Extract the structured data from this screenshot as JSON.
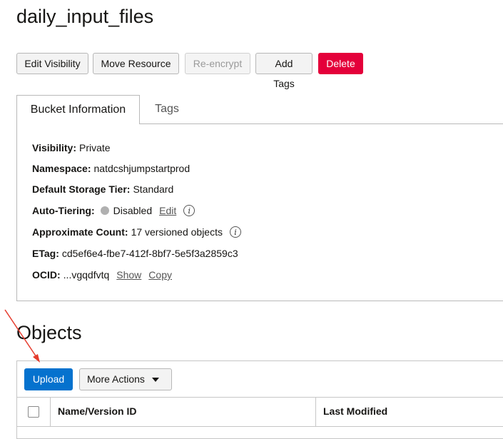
{
  "page": {
    "title": "daily_input_files"
  },
  "toolbar": {
    "edit_visibility": "Edit Visibility",
    "move_resource": "Move Resource",
    "re_encrypt": "Re-encrypt",
    "add_tags": "Add Tags",
    "delete": "Delete"
  },
  "tabs": {
    "bucket_information": "Bucket Information",
    "tags": "Tags"
  },
  "bucket_info": {
    "visibility": {
      "label": "Visibility:",
      "value": "Private"
    },
    "namespace": {
      "label": "Namespace:",
      "value": "natdcshjumpstartprod"
    },
    "storage_tier": {
      "label": "Default Storage Tier:",
      "value": "Standard"
    },
    "auto_tiering": {
      "label": "Auto-Tiering:",
      "value": "Disabled",
      "edit_link": "Edit"
    },
    "approx_count": {
      "label": "Approximate Count:",
      "value": "17 versioned objects"
    },
    "etag": {
      "label": "ETag:",
      "value": "cd5ef6e4-fbe7-412f-8bf7-5e5f3a2859c3"
    },
    "ocid": {
      "label": "OCID:",
      "value": "...vgqdfvtq",
      "show_link": "Show",
      "copy_link": "Copy"
    }
  },
  "objects": {
    "title": "Objects",
    "upload": "Upload",
    "more_actions": "More Actions",
    "columns": [
      "Name/Version ID",
      "Last Modified"
    ]
  },
  "colors": {
    "primary": "#0572ce",
    "danger": "#e4003a",
    "status_disabled": "#b0b0b0",
    "annotation_arrow": "#e53b2c"
  }
}
